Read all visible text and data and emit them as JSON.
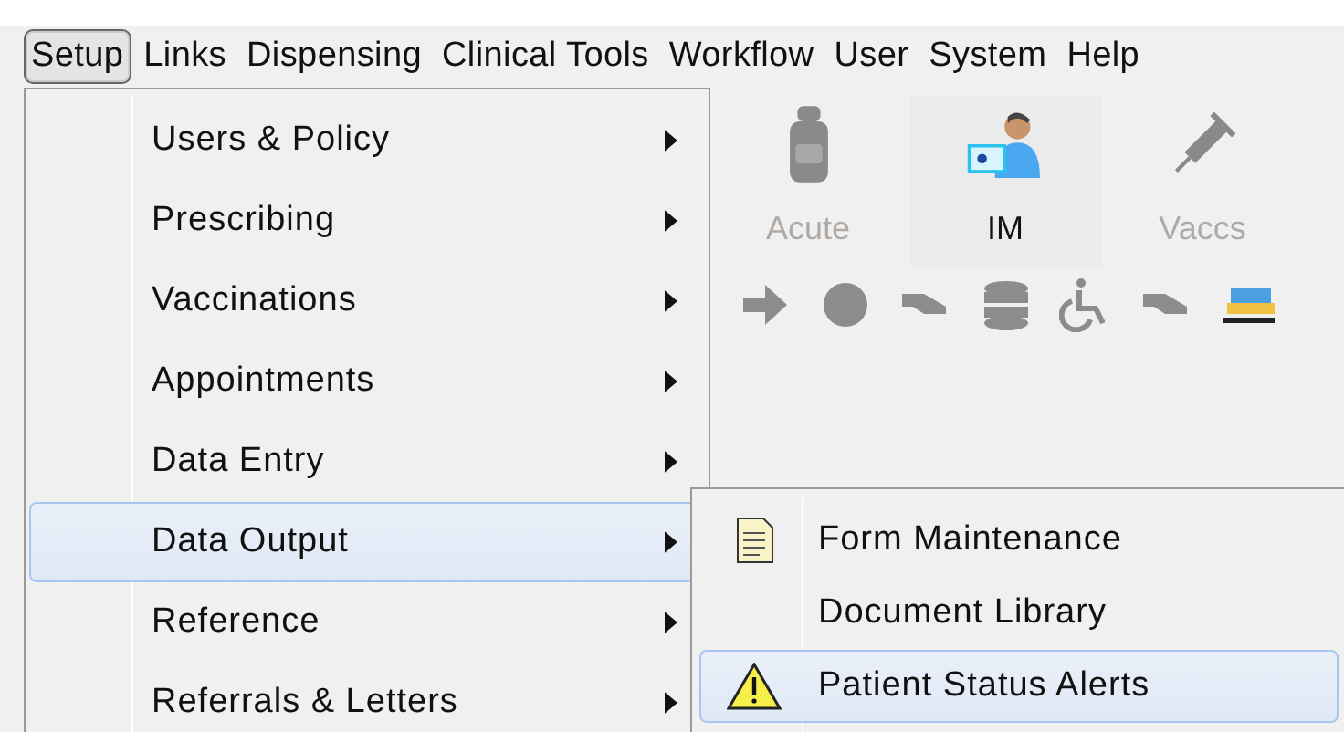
{
  "menubar": [
    {
      "label": "Setup",
      "selected": true
    },
    {
      "label": "Links",
      "selected": false
    },
    {
      "label": "Dispensing",
      "selected": false
    },
    {
      "label": "Clinical Tools",
      "selected": false
    },
    {
      "label": "Workflow",
      "selected": false
    },
    {
      "label": "User",
      "selected": false
    },
    {
      "label": "System",
      "selected": false
    },
    {
      "label": "Help",
      "selected": false
    }
  ],
  "toolbar": [
    {
      "label": "Acute",
      "kind": "bottle",
      "disabled": true
    },
    {
      "label": "IM",
      "kind": "person",
      "disabled": false
    },
    {
      "label": "Vaccs",
      "kind": "syringe",
      "disabled": true
    }
  ],
  "setup_menu": [
    {
      "label": "Users & Policy",
      "selected": false
    },
    {
      "label": "Prescribing",
      "selected": false
    },
    {
      "label": "Vaccinations",
      "selected": false
    },
    {
      "label": "Appointments",
      "selected": false
    },
    {
      "label": "Data Entry",
      "selected": false
    },
    {
      "label": "Data Output",
      "selected": true
    },
    {
      "label": "Reference",
      "selected": false
    },
    {
      "label": "Referrals & Letters",
      "selected": false
    }
  ],
  "submenu": [
    {
      "label": "Form Maintenance",
      "selected": false,
      "kind": "document"
    },
    {
      "label": "Document Library",
      "selected": false,
      "kind": "none"
    },
    {
      "label": "Patient Status Alerts",
      "selected": true,
      "kind": "warning"
    }
  ]
}
